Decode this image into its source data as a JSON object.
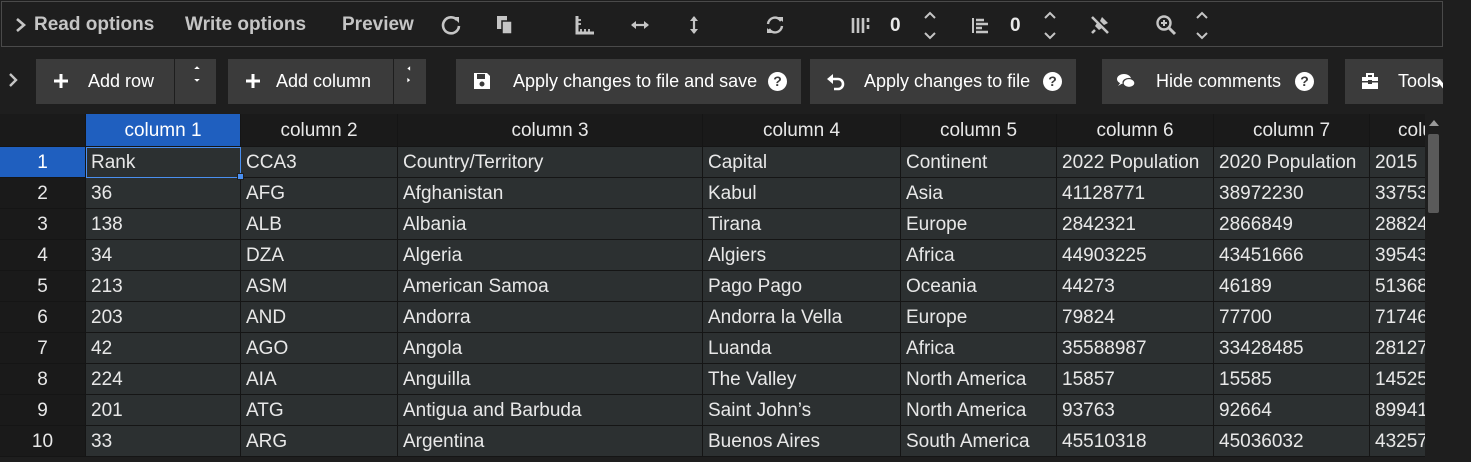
{
  "options_bar": {
    "read_options": "Read options",
    "write_options": "Write options",
    "preview": "Preview",
    "col_count": "0",
    "row_count": "0",
    "icons": [
      "chevron-right-icon",
      "reload-icon",
      "copy-icon",
      "ruler-icon",
      "resize-horizontal-icon",
      "resize-vertical-icon",
      "refresh-icon",
      "freeze-columns-icon",
      "align-left-icon",
      "pin-off-icon",
      "zoom-icon"
    ]
  },
  "toolbar": {
    "add_row": "Add row",
    "add_column": "Add column",
    "apply_save": "Apply changes to file and save",
    "apply": "Apply changes to file",
    "hide_comments": "Hide comments",
    "tools": "Tools",
    "help_glyph": "?"
  },
  "table": {
    "headers": [
      "column 1",
      "column 2",
      "column 3",
      "column 4",
      "column 5",
      "column 6",
      "column 7",
      "colu"
    ],
    "row_numbers": [
      "1",
      "2",
      "3",
      "4",
      "5",
      "6",
      "7",
      "8",
      "9",
      "10"
    ],
    "rows": [
      [
        "Rank",
        "CCA3",
        "Country/Territory",
        "Capital",
        "Continent",
        "2022 Population",
        "2020 Population",
        "2015"
      ],
      [
        "36",
        "AFG",
        "Afghanistan",
        "Kabul",
        "Asia",
        "41128771",
        "38972230",
        "33753"
      ],
      [
        "138",
        "ALB",
        "Albania",
        "Tirana",
        "Europe",
        "2842321",
        "2866849",
        "28824"
      ],
      [
        "34",
        "DZA",
        "Algeria",
        "Algiers",
        "Africa",
        "44903225",
        "43451666",
        "39543"
      ],
      [
        "213",
        "ASM",
        "American Samoa",
        "Pago Pago",
        "Oceania",
        "44273",
        "46189",
        "51368"
      ],
      [
        "203",
        "AND",
        "Andorra",
        "Andorra la Vella",
        "Europe",
        "79824",
        "77700",
        "71746"
      ],
      [
        "42",
        "AGO",
        "Angola",
        "Luanda",
        "Africa",
        "35588987",
        "33428485",
        "28127"
      ],
      [
        "224",
        "AIA",
        "Anguilla",
        "The Valley",
        "North America",
        "15857",
        "15585",
        "14525"
      ],
      [
        "201",
        "ATG",
        "Antigua and Barbuda",
        "Saint John’s",
        "North America",
        "93763",
        "92664",
        "89941"
      ],
      [
        "33",
        "ARG",
        "Argentina",
        "Buenos Aires",
        "South America",
        "45510318",
        "45036032",
        "43257"
      ]
    ]
  },
  "colors": {
    "accent": "#1f5fbf",
    "button_bg": "#3b3b3b",
    "cell_bg": "#2c3031"
  }
}
